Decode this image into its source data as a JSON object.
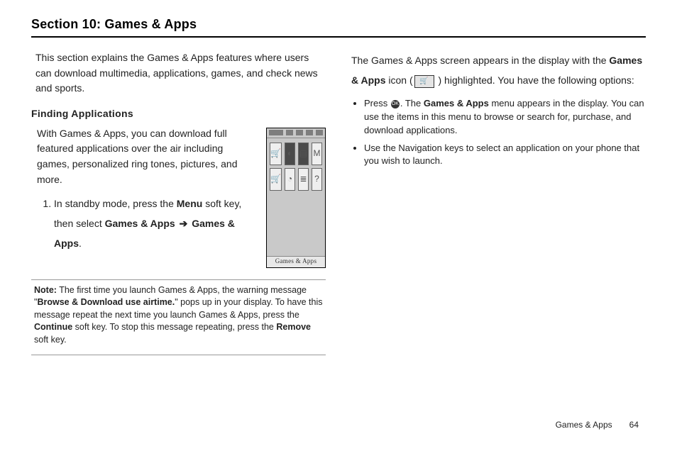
{
  "section_title": "Section 10: Games & Apps",
  "left": {
    "intro": "This section explains the Games & Apps features where users can download multimedia, applications, games, and check news and sports.",
    "subhead": "Finding Applications",
    "finding_para": "With Games & Apps, you can download full featured applications over the air including games, personalized ring tones, pictures, and more.",
    "step1_pre": "In standby mode, press the ",
    "step1_menu": "Menu",
    "step1_mid": " soft key, then select ",
    "step1_path1": "Games & Apps",
    "step1_arrow": "➔",
    "step1_path2": "Games & Apps",
    "step1_end": ".",
    "note_label": "Note:",
    "note_a": " The first time you launch Games & Apps, the warning message \"",
    "note_b": "Browse & Download use airtime.",
    "note_c": "\" pops up in your display. To have this message repeat the next time you launch Games & Apps, press the ",
    "note_d": "Continue",
    "note_e": " soft key. To stop this message repeating, press the ",
    "note_f": "Remove",
    "note_g": " soft key."
  },
  "right": {
    "p1a": "The Games & Apps screen appears in the display with the ",
    "p1b": "Games & Apps",
    "p1c": " icon (",
    "p1d": " ) highlighted. You have the following options:",
    "bullet1_a": "Press ",
    "bullet1_b": ". The ",
    "bullet1_c": "Games & Apps",
    "bullet1_d": " menu appears in the display. You can use the items in this menu to browse or search for, purchase, and download applications.",
    "bullet2": "Use the Navigation keys to select an application on your phone that you wish to launch."
  },
  "phone": {
    "footer": "Games & Apps"
  },
  "footer": {
    "section": "Games & Apps",
    "page": "64"
  },
  "icons": {
    "cart": "🛒",
    "ok": "OK"
  }
}
